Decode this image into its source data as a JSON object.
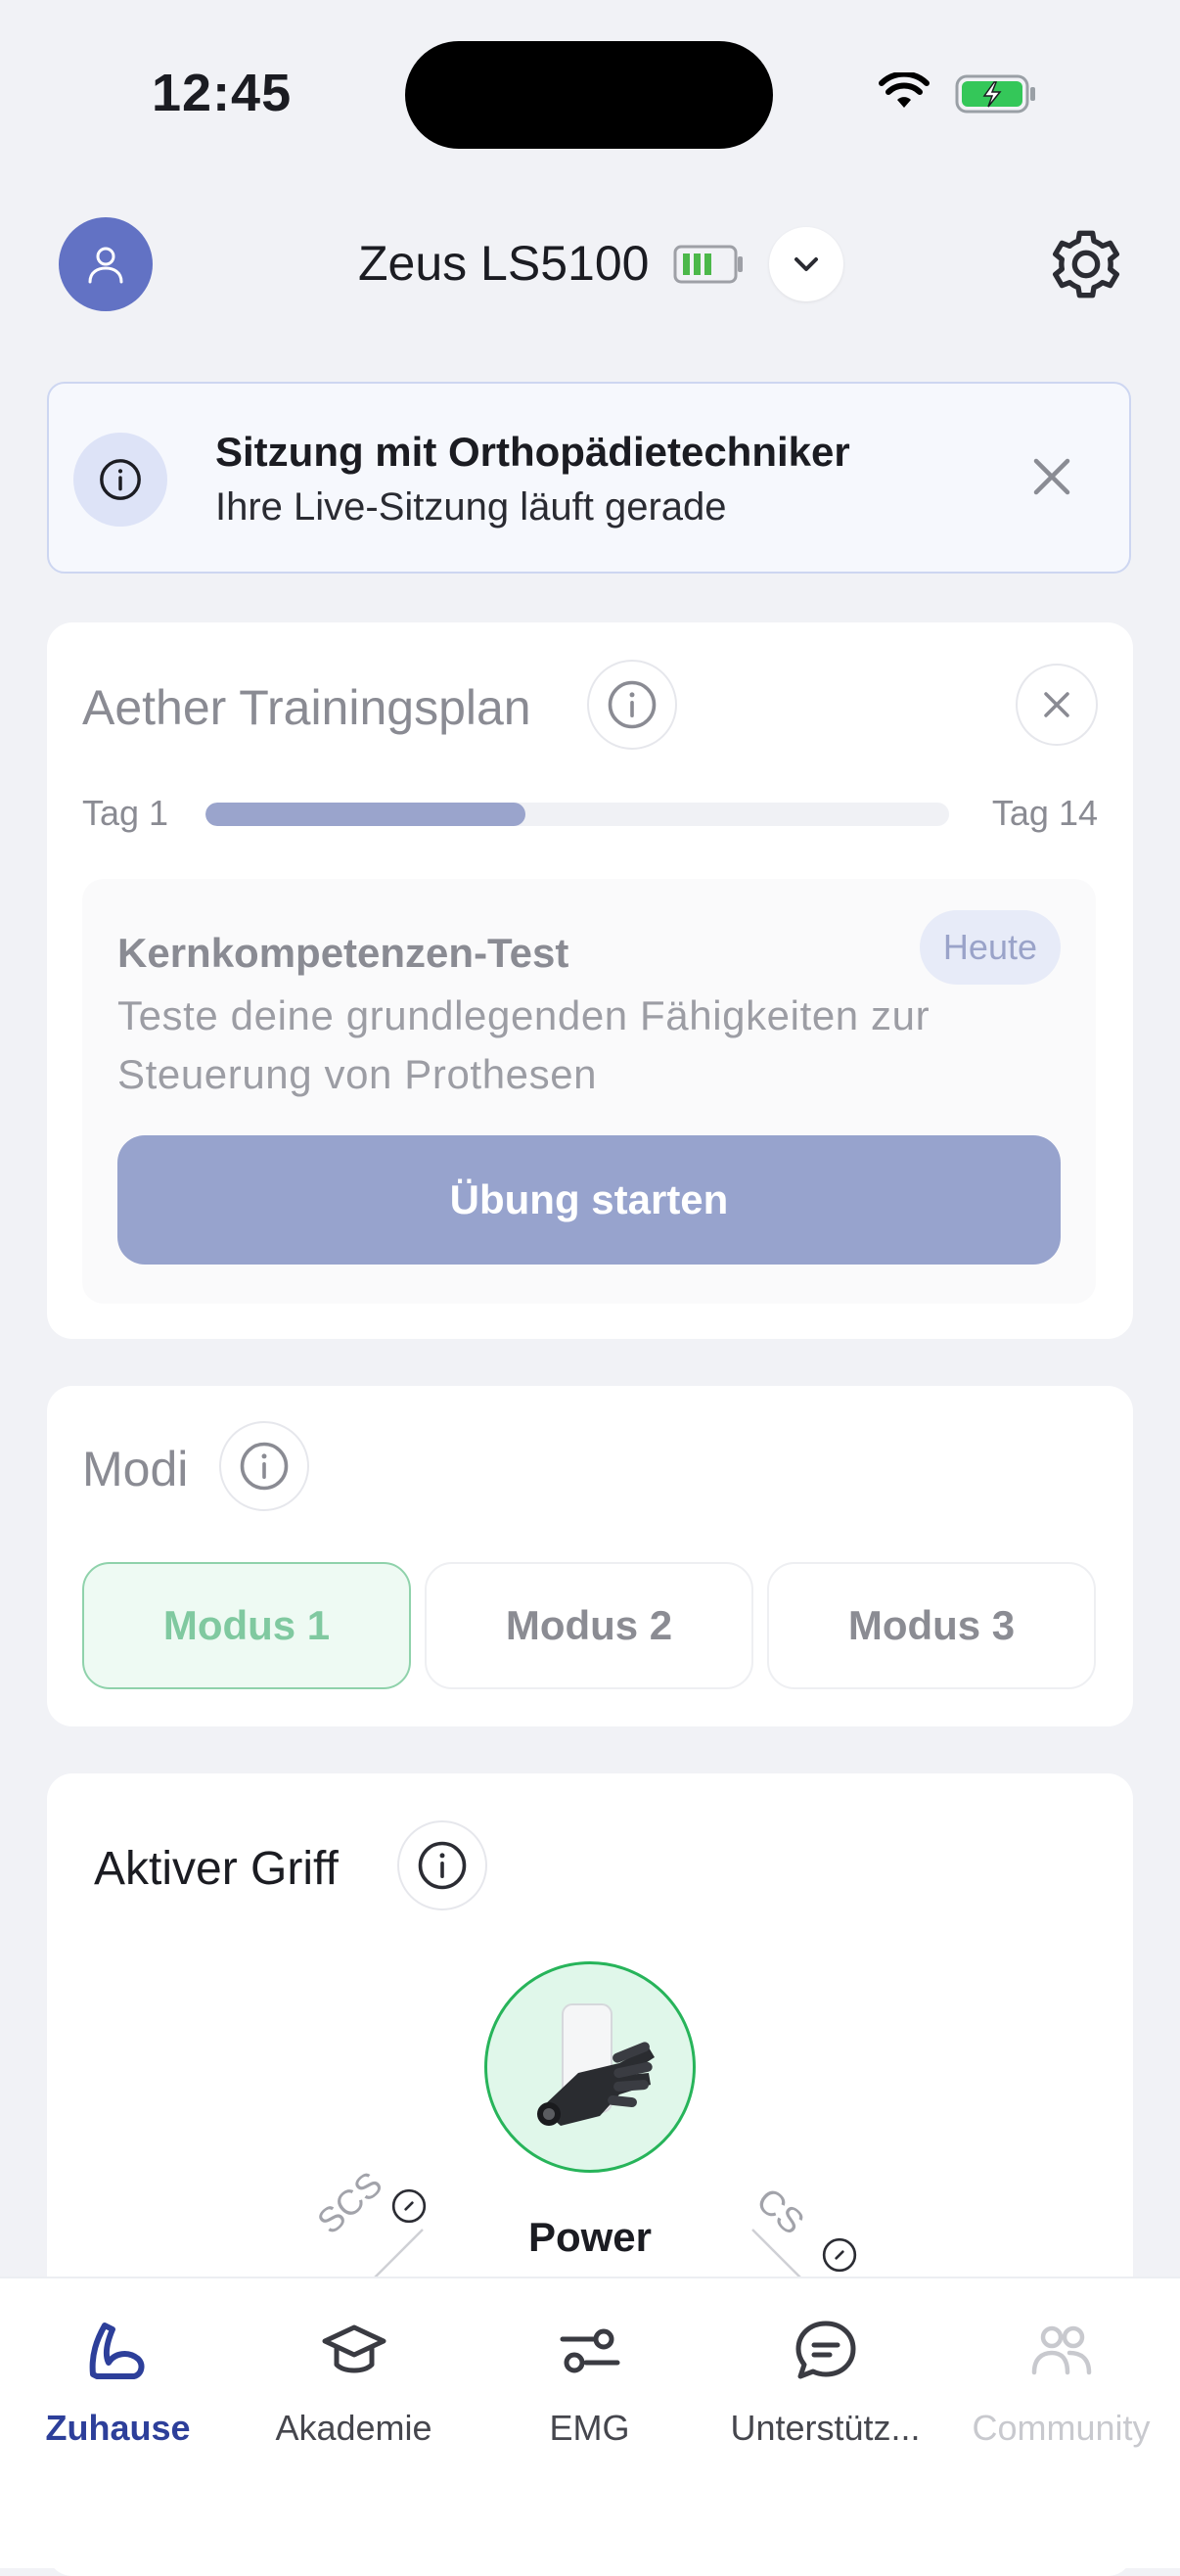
{
  "status_bar": {
    "time": "12:45"
  },
  "header": {
    "device_name": "Zeus LS5100"
  },
  "session_banner": {
    "title": "Sitzung mit Orthopädietechniker",
    "subtitle": "Ihre Live-Sitzung läuft gerade"
  },
  "training": {
    "title": "Aether Trainingsplan",
    "start_day": "Tag 1",
    "end_day": "Tag 14",
    "progress": 0.43,
    "exercise": {
      "title": "Kernkompetenzen-Test",
      "badge": "Heute",
      "description": "Teste deine grundlegenden Fähigkeiten zur Steuerung von Prothesen",
      "button": "Übung starten"
    }
  },
  "modes": {
    "title": "Modi",
    "items": [
      {
        "label": "Modus 1",
        "active": true
      },
      {
        "label": "Modus 2",
        "active": false
      },
      {
        "label": "Modus 3",
        "active": false
      }
    ]
  },
  "grip": {
    "title": "Aktiver Griff",
    "name": "Power",
    "left_label": "SCS",
    "right_label": "CS"
  },
  "tabs": [
    {
      "label": "Zuhause",
      "icon": "arm-icon",
      "state": "active"
    },
    {
      "label": "Akademie",
      "icon": "graduation-cap-icon",
      "state": "normal"
    },
    {
      "label": "EMG",
      "icon": "sliders-icon",
      "state": "normal"
    },
    {
      "label": "Unterstütz...",
      "icon": "chat-icon",
      "state": "normal"
    },
    {
      "label": "Community",
      "icon": "people-icon",
      "state": "disabled"
    }
  ],
  "colors": {
    "accent": "#2d3f9a",
    "avatar": "#6272c4",
    "active_mode": "#80c9a0",
    "grip_ring": "#27b45a"
  }
}
